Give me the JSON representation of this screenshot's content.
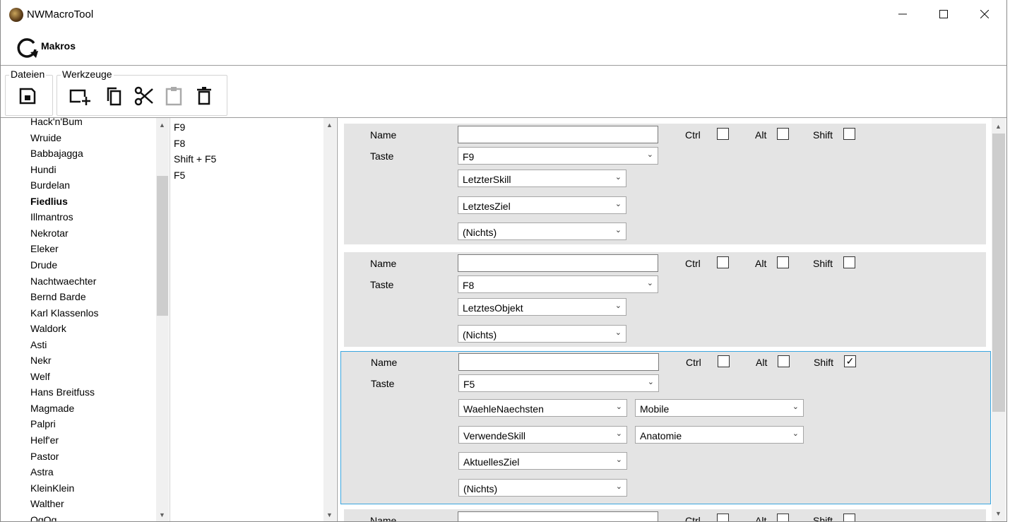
{
  "window": {
    "title": "NWMacroTool",
    "minimize": "—",
    "maximize": "☐",
    "close": "✕"
  },
  "ribbon": {
    "tab_label": "Makros",
    "groups": [
      {
        "label": "Dateien"
      },
      {
        "label": "Werkzeuge"
      }
    ]
  },
  "characters": [
    "Hack'n'Bum",
    "Wruide",
    "Babbajagga",
    "Hundi",
    "Burdelan",
    "Fiedlius",
    "Illmantros",
    "Nekrotar",
    "Eleker",
    "Drude",
    "Nachtwaechter",
    "Bernd Barde",
    "Karl Klassenlos",
    "Waldork",
    "Asti",
    "Nekr",
    "Welf",
    "Hans Breitfuss",
    "Magmade",
    "Palpri",
    "Helf'er",
    "Pastor",
    "Astra",
    "KleinKlein",
    "Walther",
    "OgOg"
  ],
  "selected_character": "Fiedlius",
  "macro_keys": [
    "F9",
    "F8",
    "Shift + F5",
    "F5"
  ],
  "labels": {
    "name": "Name",
    "taste": "Taste",
    "ctrl": "Ctrl",
    "alt": "Alt",
    "shift": "Shift"
  },
  "macros": [
    {
      "name": "",
      "key": "F9",
      "ctrl": false,
      "alt": false,
      "shift": false,
      "actions": [
        [
          "LetzterSkill"
        ],
        [
          "LetztesZiel"
        ],
        [
          "(Nichts)"
        ]
      ]
    },
    {
      "name": "",
      "key": "F8",
      "ctrl": false,
      "alt": false,
      "shift": false,
      "actions": [
        [
          "LetztesObjekt"
        ],
        [
          "(Nichts)"
        ]
      ]
    },
    {
      "name": "",
      "key": "F5",
      "ctrl": false,
      "alt": false,
      "shift": true,
      "actions": [
        [
          "WaehleNaechsten",
          "Mobile"
        ],
        [
          "VerwendeSkill",
          "Anatomie"
        ],
        [
          "AktuellesZiel"
        ],
        [
          "(Nichts)"
        ]
      ]
    }
  ],
  "check_mark": "✓",
  "icons": {
    "chevron": "⌄",
    "scroll_up": "▲",
    "scroll_down": "▼"
  }
}
